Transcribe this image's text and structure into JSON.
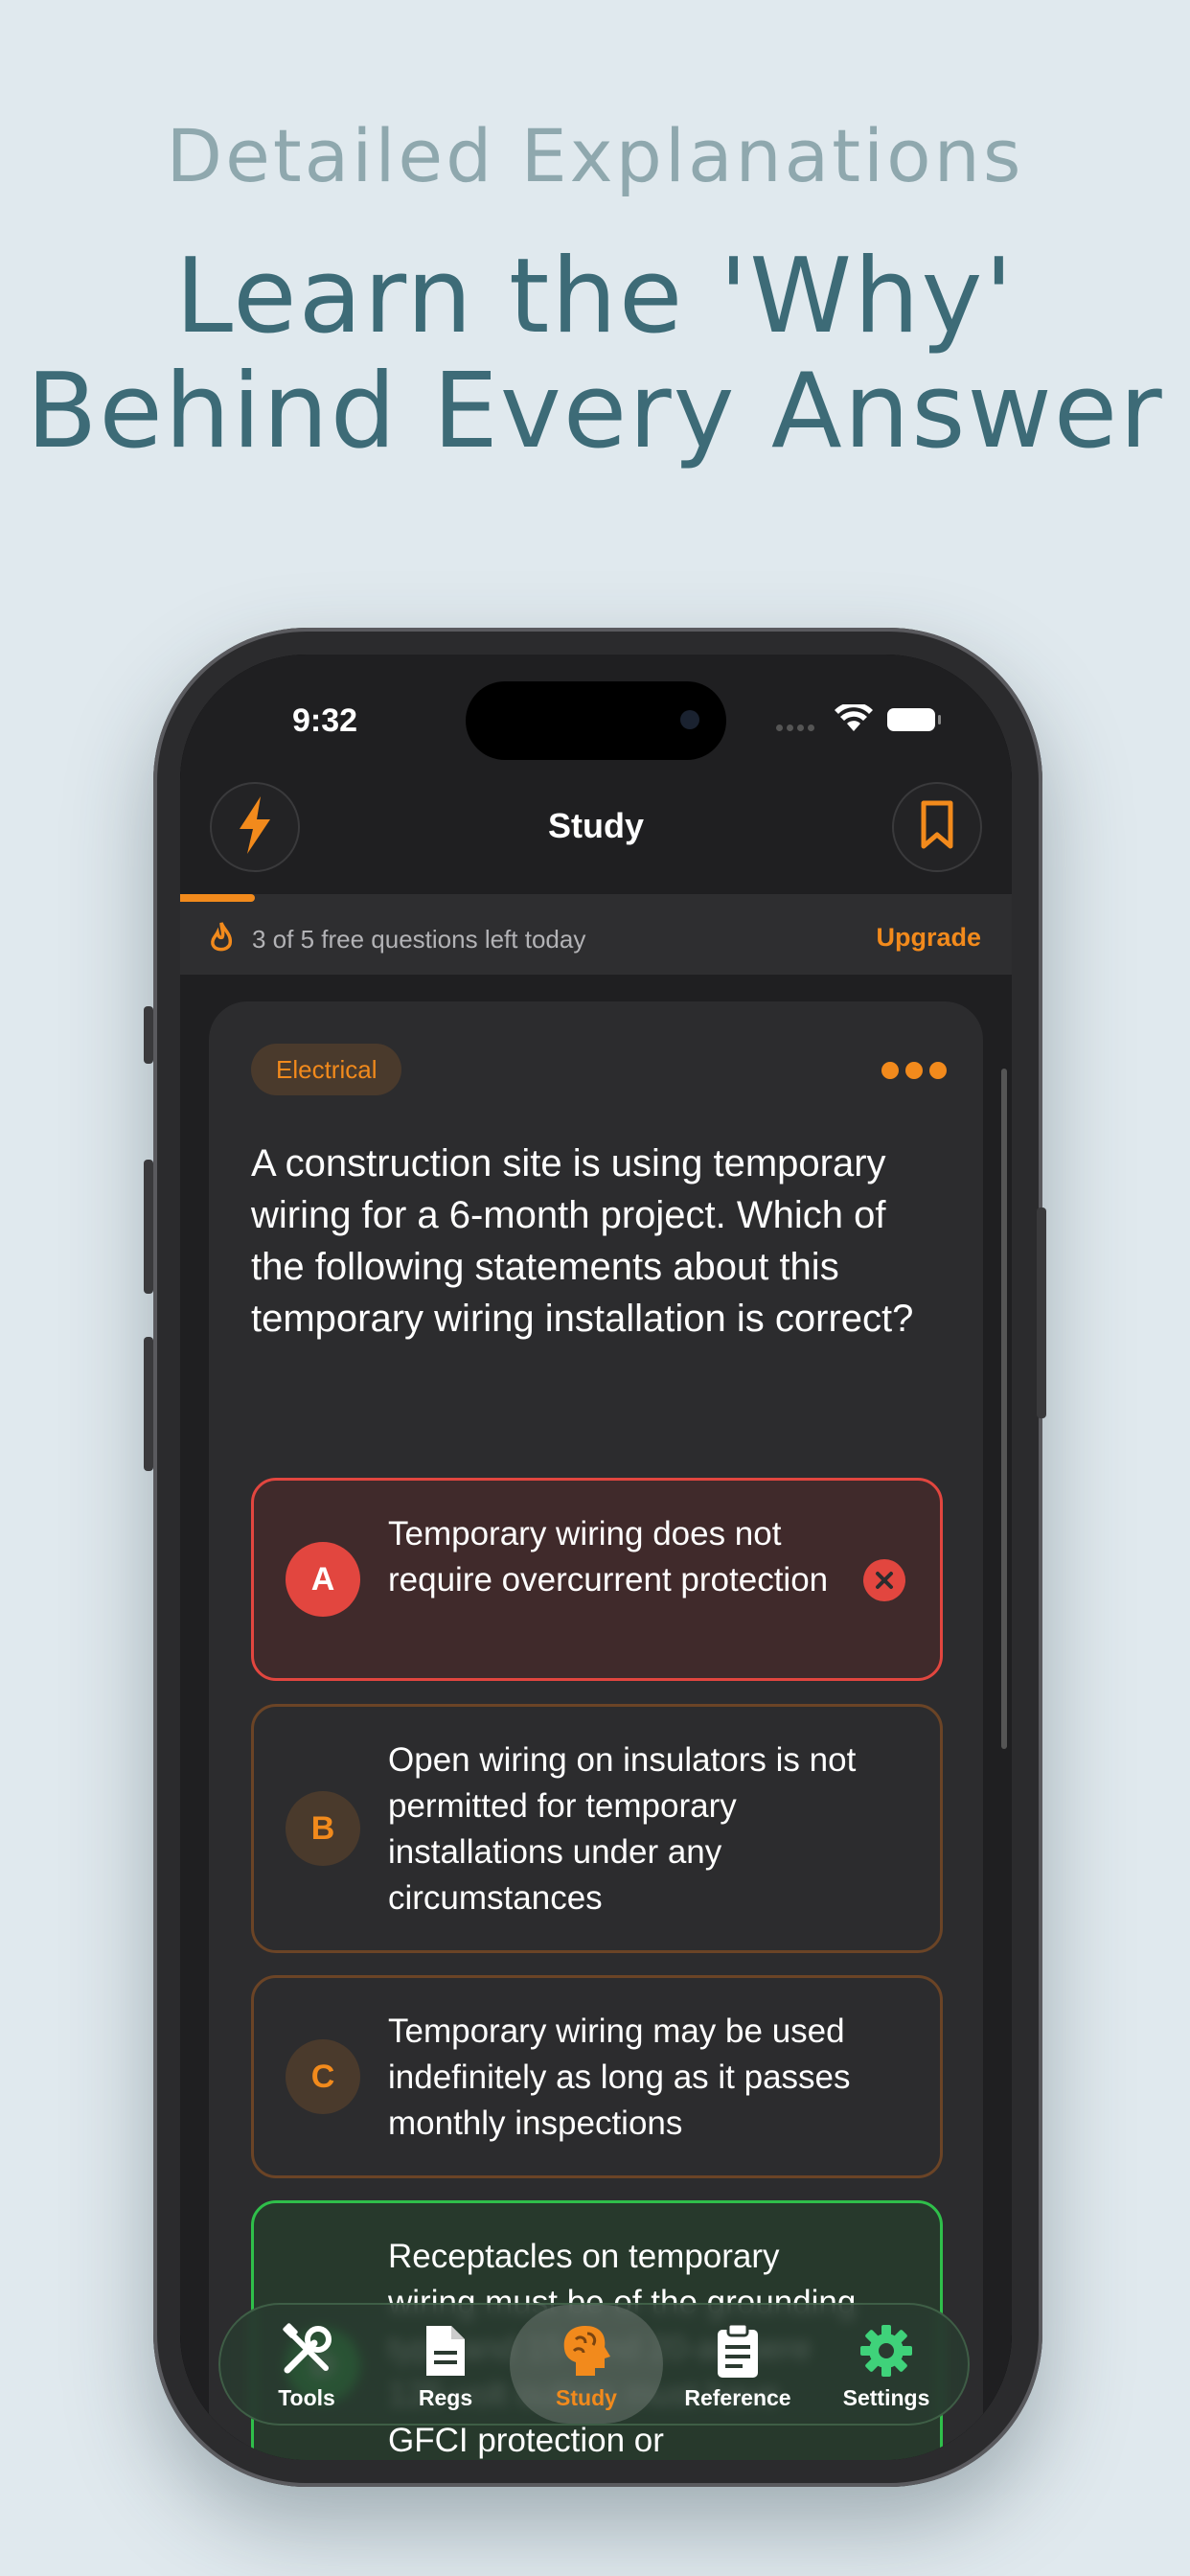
{
  "headline": {
    "subtitle": "Detailed Explanations",
    "title_line1": "Learn the 'Why'",
    "title_line2": "Behind Every Answer"
  },
  "status_bar": {
    "time": "9:32"
  },
  "nav": {
    "title": "Study",
    "left_icon": "lightning-bolt-icon",
    "right_icon": "bookmark-icon"
  },
  "quota": {
    "text": "3 of 5 free questions left today",
    "upgrade_label": "Upgrade",
    "progress_fraction": 0.09
  },
  "question_card": {
    "category": "Electrical",
    "question": "A construction site is using temporary wiring for a 6-month project. Which of the following statements about this temporary wiring installation is correct?",
    "options": [
      {
        "letter": "A",
        "text": "Temporary wiring does not require overcurrent protection",
        "state": "wrong"
      },
      {
        "letter": "B",
        "text": "Open wiring on insulators is not permitted for temporary installations under any circumstances",
        "state": "neutral"
      },
      {
        "letter": "C",
        "text": "Temporary wiring may be used indefinitely as long as it passes monthly inspections",
        "state": "neutral"
      },
      {
        "letter": "D",
        "text": "Receptacles on temporary wiring must be of the grounding type and 15- and 20-ampere 125-volt outlets must have GFCI protection or",
        "state": "correct"
      }
    ]
  },
  "tabbar": {
    "tabs": [
      {
        "label": "Tools",
        "icon": "tools-icon"
      },
      {
        "label": "Regs",
        "icon": "document-icon"
      },
      {
        "label": "Study",
        "icon": "brain-icon",
        "active": true
      },
      {
        "label": "Reference",
        "icon": "clipboard-icon"
      },
      {
        "label": "Settings",
        "icon": "gear-icon"
      }
    ]
  },
  "colors": {
    "accent": "#f28a1c",
    "wrong": "#e2463f",
    "correct": "#2fbf4a",
    "headline": "#3d6b77",
    "background": "#e0e9ee"
  }
}
